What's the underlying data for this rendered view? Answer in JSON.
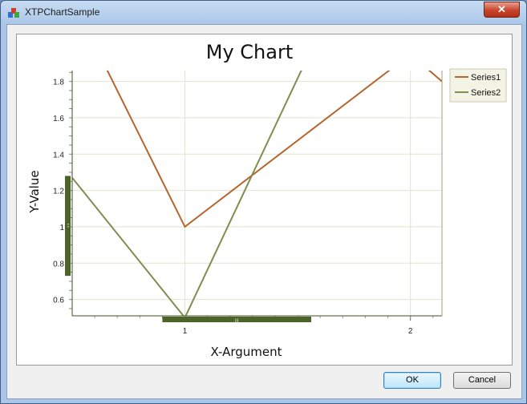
{
  "window": {
    "title": "XTPChartSample",
    "close_glyph": "✕"
  },
  "buttons": {
    "ok": "OK",
    "cancel": "Cancel"
  },
  "colors": {
    "series1": "#b5652e",
    "series2": "#7c8f4f",
    "scrollbar": "#4c6428",
    "grid": "#e3e3cc",
    "axis": "#3d4f20"
  },
  "chart_data": {
    "type": "line",
    "title": "My Chart",
    "xlabel": "X-Argument",
    "ylabel": "Y-Value",
    "xlim": [
      0.5,
      2.14
    ],
    "ylim": [
      0.51,
      1.86
    ],
    "x_ticks": [
      1,
      2
    ],
    "y_ticks": [
      0.6,
      0.8,
      1,
      1.2,
      1.4,
      1.6,
      1.8
    ],
    "y_tick_labels": [
      "0.6",
      "0.8",
      "1",
      "1.2",
      "1.4",
      "1.6",
      "1.8"
    ],
    "x_tick_labels": [
      "1",
      "2"
    ],
    "grid": true,
    "legend_position": "top-right",
    "series": [
      {
        "name": "Series1",
        "x": [
          0.5,
          1,
          2,
          2.14
        ],
        "y": [
          2.25,
          1.0,
          1.95,
          1.8
        ]
      },
      {
        "name": "Series2",
        "x": [
          0.5,
          1,
          1.55
        ],
        "y": [
          1.27,
          0.5,
          1.95
        ]
      }
    ],
    "x_scrollbar": {
      "start": 0.9,
      "end": 1.56
    },
    "y_scrollbar": {
      "start": 0.73,
      "end": 1.28
    }
  }
}
